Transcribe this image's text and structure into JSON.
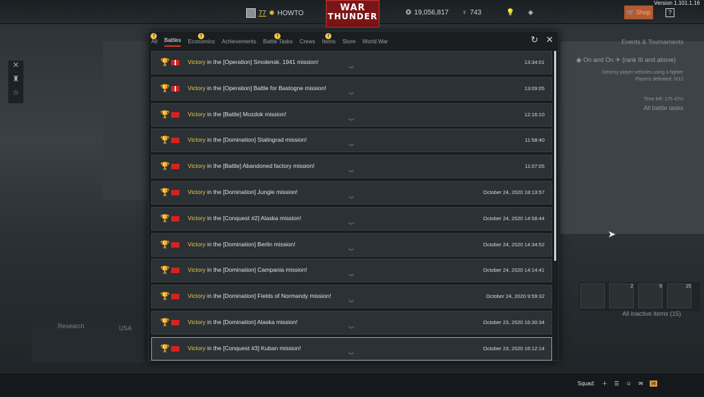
{
  "version": "Version 1.101.1.16",
  "player": {
    "rank": "77",
    "name": "HOWTO"
  },
  "logo": {
    "line1": "WAR",
    "line2": "THUNDER"
  },
  "currency": {
    "silver": "19,056,817",
    "gold": "743"
  },
  "shop_label": "Shop",
  "help_label": "?",
  "right_panel": {
    "title": "Events & Tournaments",
    "task": "On and On",
    "task_suffix": "(rank III and above)",
    "task_desc": "Destroy player vehicles using a fighter",
    "players_defeated": "Players defeated: 0/12",
    "time_left": "Time left: 17h 47m",
    "all_tasks": "All battle tasks",
    "inactive_items": "All inactive items (15)",
    "item_counts": [
      "2",
      "6",
      "15"
    ]
  },
  "research": {
    "label": "Research",
    "nation": "USA"
  },
  "squad_label": "Squad:",
  "tabs": [
    {
      "label": "All",
      "warn": true
    },
    {
      "label": "Battles",
      "warn": false
    },
    {
      "label": "Economics",
      "warn": true
    },
    {
      "label": "Achievements",
      "warn": false
    },
    {
      "label": "Battle Tasks",
      "warn": true
    },
    {
      "label": "Crews",
      "warn": false
    },
    {
      "label": "Items",
      "warn": true
    },
    {
      "label": "Store",
      "warn": false
    },
    {
      "label": "World War",
      "warn": false
    }
  ],
  "active_tab": "Battles",
  "victory_word": "Victory",
  "rows": [
    {
      "text": " in the [Operation] Smolensk. 1941 mission!",
      "time": "13:34:01",
      "flag": "ussr-old"
    },
    {
      "text": " in the [Operation] Battle for Bastogne mission!",
      "time": "13:09:05",
      "flag": "ussr-old"
    },
    {
      "text": " in the [Battle] Mozdok mission!",
      "time": "12:16:10",
      "flag": "ussr"
    },
    {
      "text": " in the [Domination] Stalingrad mission!",
      "time": "11:58:40",
      "flag": "ussr"
    },
    {
      "text": " in the [Battle] Abandoned factory mission!",
      "time": "11:07:05",
      "flag": "ussr"
    },
    {
      "text": " in the [Domination] Jungle mission!",
      "time": "October 24, 2020 18:13:57",
      "flag": "ussr"
    },
    {
      "text": " in the [Conquest #2] Alaska mission!",
      "time": "October 24, 2020 14:58:44",
      "flag": "ussr"
    },
    {
      "text": " in the [Domination] Berlin mission!",
      "time": "October 24, 2020 14:34:52",
      "flag": "ussr"
    },
    {
      "text": " in the [Domination] Campania mission!",
      "time": "October 24, 2020 14:14:41",
      "flag": "ussr"
    },
    {
      "text": " in the [Domination] Fields of Normandy mission!",
      "time": "October 24, 2020 9:59:32",
      "flag": "ussr"
    },
    {
      "text": " in the [Domination] Alaska mission!",
      "time": "October 23, 2020 16:30:34",
      "flag": "ussr"
    },
    {
      "text": " in the [Conquest #3] Kuban mission!",
      "time": "October 23, 2020 16:12:14",
      "flag": "ussr"
    }
  ],
  "colors": {
    "accent": "#cf3a2d",
    "victory": "#f0c84a",
    "flag_red": "#d4231d"
  }
}
